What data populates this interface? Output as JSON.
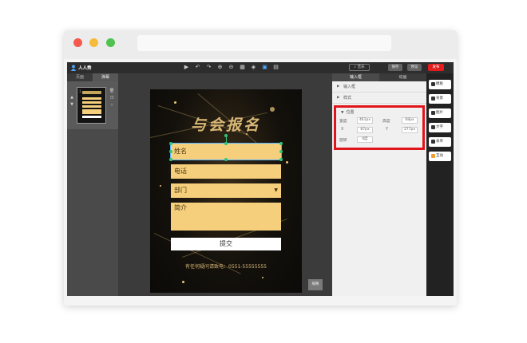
{
  "app": {
    "logo": "人人秀",
    "toolbar": {
      "music_label": "♪ 音乐",
      "save_label": "保存",
      "preview_label": "预览",
      "publish_label": "发布",
      "accent_color": "#e51c1c"
    }
  },
  "left_panel": {
    "tabs": [
      "页面",
      "弹幕"
    ],
    "active_tab": 1,
    "page_number": "1"
  },
  "canvas": {
    "title": "与会报名",
    "fields": {
      "name": "姓名",
      "phone": "电话",
      "department": "部门",
      "intro": "简介"
    },
    "submit_label": "提交",
    "contact_text": "有任何疑问请致电：0551-55555555",
    "field_color": "#f6cf7c",
    "zoom_label": "缩略"
  },
  "right_panel": {
    "tabs": [
      "输入框",
      "动画"
    ],
    "active_tab": 0,
    "sections": {
      "input": "输入框",
      "style": "样式",
      "position": "位置"
    },
    "position": {
      "width_label": "宽度",
      "width_value": "461px",
      "height_label": "高度",
      "height_value": "68px",
      "x_label": "X",
      "x_value": "87px",
      "y_label": "Y",
      "y_value": "277px",
      "rotate_label": "旋转",
      "rotate_value": "0度"
    }
  },
  "tool_strip": {
    "items": [
      "模板",
      "背景",
      "图片",
      "文字",
      "表单",
      "互动"
    ]
  }
}
